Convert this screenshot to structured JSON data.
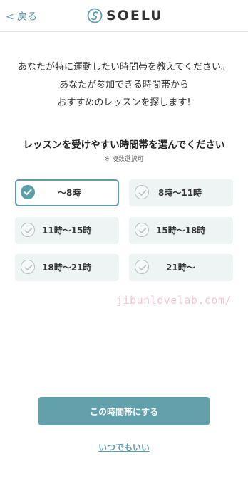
{
  "header": {
    "back_label": "< 戻る",
    "logo_text": "SOELU",
    "logo_icon": "soelu-logo-icon"
  },
  "intro": {
    "lines": [
      "あなたが特に運動したい時間帯を教えてください。",
      "あなたが参加できる時間帯から",
      "おすすめのレッスンを探します!"
    ]
  },
  "section": {
    "title": "レッスンを受けやすい時間帯を選んでください",
    "note": "※ 複数選択可"
  },
  "options": [
    {
      "label": "〜8時",
      "selected": true
    },
    {
      "label": "8時〜11時",
      "selected": false
    },
    {
      "label": "11時〜15時",
      "selected": false
    },
    {
      "label": "15時〜18時",
      "selected": false
    },
    {
      "label": "18時〜21時",
      "selected": false
    },
    {
      "label": "21時〜",
      "selected": false
    }
  ],
  "watermark": "jibunlovelab.com/",
  "actions": {
    "submit_label": "この時間帯にする",
    "skip_label": "いつでもいい"
  },
  "colors": {
    "accent": "#5e9ea8",
    "button": "#62a1ac",
    "option_bg": "#eef4f4",
    "watermark": "#f3c6d6"
  }
}
